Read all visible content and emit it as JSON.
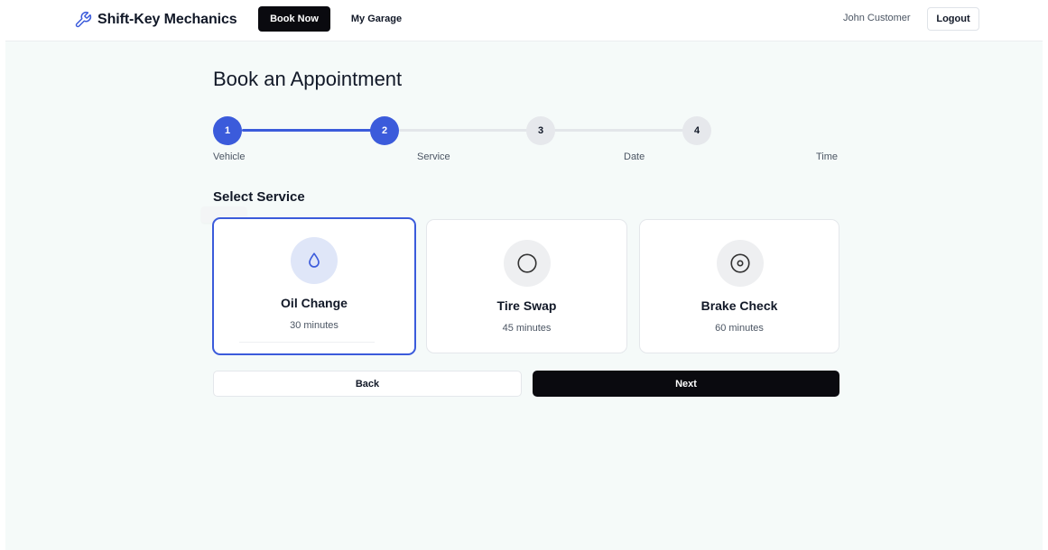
{
  "header": {
    "brand_name": "Shift-Key Mechanics",
    "brand_icon": "wrench-icon",
    "nav": {
      "book_now": "Book Now",
      "my_garage": "My Garage"
    },
    "user_name": "John Customer",
    "logout_label": "Logout"
  },
  "main": {
    "title": "Book an Appointment",
    "steps": [
      {
        "number": "1",
        "label": "Vehicle",
        "state": "complete"
      },
      {
        "number": "2",
        "label": "Service",
        "state": "active"
      },
      {
        "number": "3",
        "label": "Date",
        "state": "pending"
      },
      {
        "number": "4",
        "label": "Time",
        "state": "pending"
      }
    ],
    "section_title": "Select Service",
    "services": [
      {
        "name": "Oil Change",
        "duration": "30 minutes",
        "icon": "droplet-icon",
        "selected": true
      },
      {
        "name": "Tire Swap",
        "duration": "45 minutes",
        "icon": "circle-icon",
        "selected": false
      },
      {
        "name": "Brake Check",
        "duration": "60 minutes",
        "icon": "disc-icon",
        "selected": false
      }
    ],
    "back_label": "Back",
    "next_label": "Next"
  },
  "colors": {
    "accent": "#3b5bdb",
    "primary_button": "#0a0a0f",
    "page_background": "#f5faf9"
  }
}
